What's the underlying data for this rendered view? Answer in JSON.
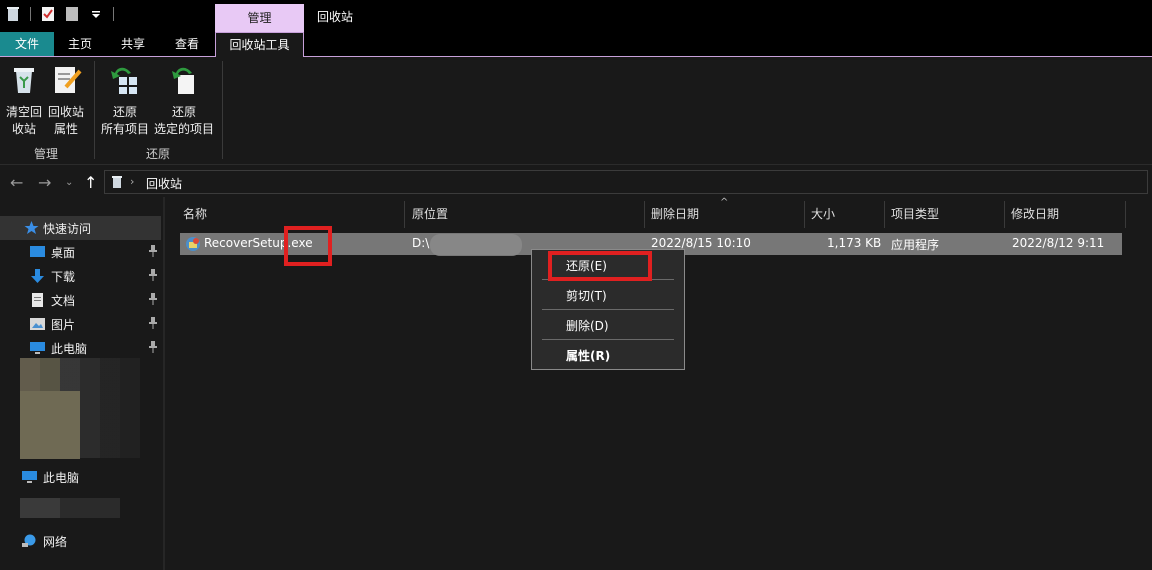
{
  "window": {
    "title": "回收站",
    "context_tab_group": "管理"
  },
  "tabs": {
    "file": "文件",
    "home": "主页",
    "share": "共享",
    "view": "查看",
    "tools": "回收站工具"
  },
  "ribbon": {
    "empty_bin": [
      "清空回",
      "收站"
    ],
    "bin_props": [
      "回收站",
      "属性"
    ],
    "restore_all": [
      "还原",
      "所有项目"
    ],
    "restore_selected": [
      "还原",
      "选定的项目"
    ],
    "group_manage": "管理",
    "group_restore": "还原"
  },
  "address": {
    "crumb": "回收站"
  },
  "nav": {
    "quick_access": "快速访问",
    "items": [
      "桌面",
      "下载",
      "文档",
      "图片",
      "此电脑"
    ],
    "this_pc": "此电脑",
    "network": "网络"
  },
  "columns": {
    "name": "名称",
    "original": "原位置",
    "deleted": "删除日期",
    "size": "大小",
    "type": "项目类型",
    "modified": "修改日期"
  },
  "file": {
    "name": "RecoverSetup",
    "ext": ".exe",
    "original": "D:\\",
    "deleted": "2022/8/15 10:10",
    "size": "1,173 KB",
    "type": "应用程序",
    "modified": "2022/8/12 9:11"
  },
  "context_menu": {
    "restore": "还原(E)",
    "cut": "剪切(T)",
    "delete": "删除(D)",
    "properties": "属性(R)"
  },
  "colors": {
    "highlight_box": "#e02020",
    "file_tab": "#1a8a8f",
    "context_tab": "#e8c9f5"
  }
}
